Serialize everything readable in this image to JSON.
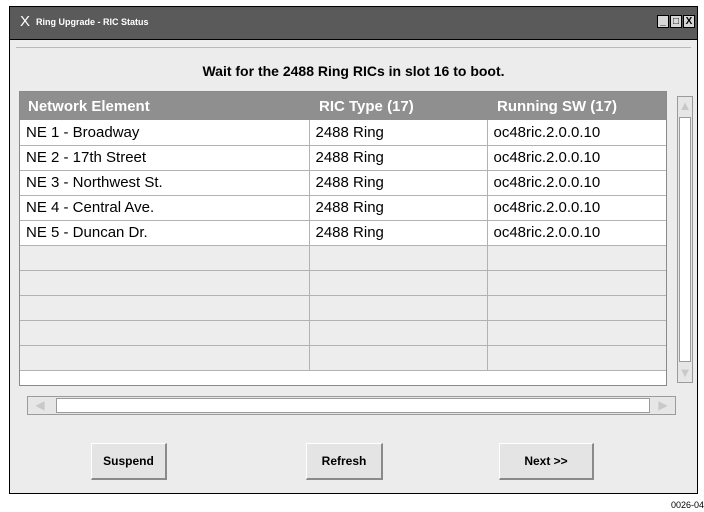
{
  "window": {
    "title": "Ring Upgrade - RIC Status",
    "controls": [
      "_",
      "□",
      "X"
    ]
  },
  "heading": "Wait for the 2488 Ring RICs in slot 16 to boot.",
  "table": {
    "headers": [
      "Network Element",
      "RIC Type (17)",
      "Running SW (17)"
    ],
    "rows": [
      [
        "NE 1 - Broadway",
        "2488 Ring",
        "oc48ric.2.0.0.10"
      ],
      [
        "NE 2 - 17th Street",
        "2488 Ring",
        "oc48ric.2.0.0.10"
      ],
      [
        "NE 3 - Northwest St.",
        "2488 Ring",
        "oc48ric.2.0.0.10"
      ],
      [
        "NE 4 - Central Ave.",
        "2488 Ring",
        "oc48ric.2.0.0.10"
      ],
      [
        "NE 5 - Duncan Dr.",
        "2488 Ring",
        "oc48ric.2.0.0.10"
      ],
      [
        "",
        "",
        ""
      ],
      [
        "",
        "",
        ""
      ],
      [
        "",
        "",
        ""
      ],
      [
        "",
        "",
        ""
      ],
      [
        "",
        "",
        ""
      ]
    ]
  },
  "buttons": {
    "suspend": "Suspend",
    "refresh": "Refresh",
    "next": "Next >>"
  },
  "figure_id": "0026-04",
  "colors": {
    "titlebar": "#5a5a5a",
    "header": "#8f8f8f",
    "window_bg": "#ececec"
  }
}
